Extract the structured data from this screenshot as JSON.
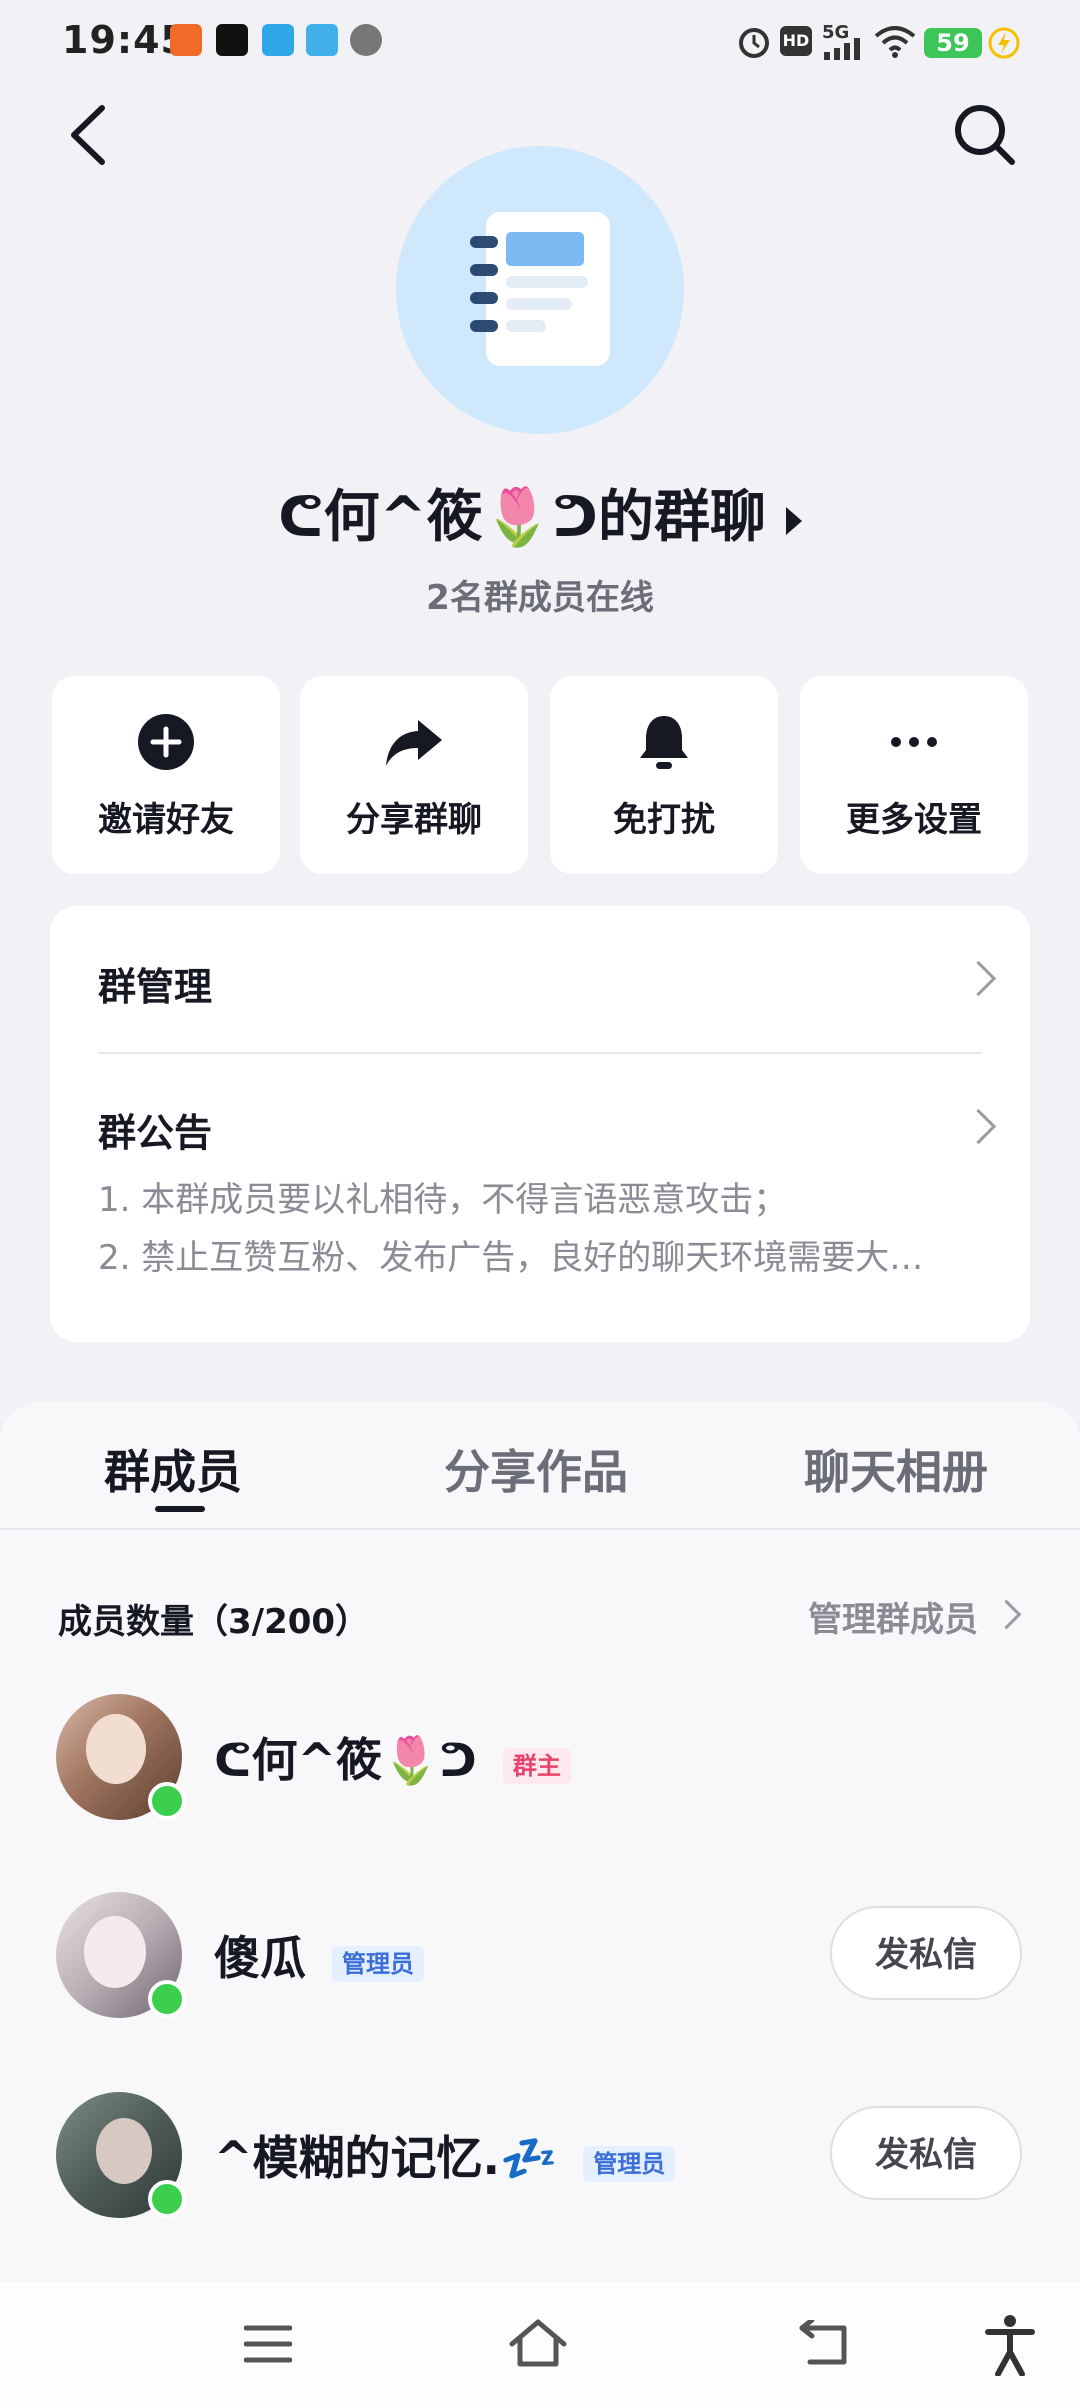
{
  "status_bar": {
    "time": "19:45",
    "battery": "59",
    "network": "5G",
    "hd": "HD"
  },
  "header": {
    "group_name": "ᕦ何^筱🌷ᕤ的群聊",
    "online_text": "2名群成员在线"
  },
  "actions": [
    {
      "label": "邀请好友",
      "icon": "plus-circle-icon"
    },
    {
      "label": "分享群聊",
      "icon": "share-arrow-icon"
    },
    {
      "label": "免打扰",
      "icon": "bell-icon"
    },
    {
      "label": "更多设置",
      "icon": "more-dots-icon"
    }
  ],
  "settings": {
    "manage_label": "群管理",
    "notice_label": "群公告",
    "notice_lines": [
      "1. 本群成员要以礼相待，不得言语恶意攻击；",
      "2. 禁止互赞互粉、发布广告，良好的聊天环境需要大…"
    ]
  },
  "tabs": [
    {
      "label": "群成员",
      "active": true
    },
    {
      "label": "分享作品",
      "active": false
    },
    {
      "label": "聊天相册",
      "active": false
    }
  ],
  "members_section": {
    "count_label": "成员数量（3/200）",
    "manage_link": "管理群成员"
  },
  "members": [
    {
      "name": "ᕦ何^筱🌷ᕤ",
      "badge": "群主",
      "role": "owner",
      "online": true,
      "dm_button": ""
    },
    {
      "name": "傻瓜",
      "badge": "管理员",
      "role": "admin",
      "online": true,
      "dm_button": "发私信"
    },
    {
      "name": "^模糊的记忆.💤",
      "badge": "管理员",
      "role": "admin",
      "online": true,
      "dm_button": "发私信"
    }
  ],
  "colors": {
    "page_bg": "#f1f1f6",
    "online_dot": "#3ccf4e",
    "owner_badge": "#e8446b",
    "admin_badge": "#3b6fd6"
  }
}
